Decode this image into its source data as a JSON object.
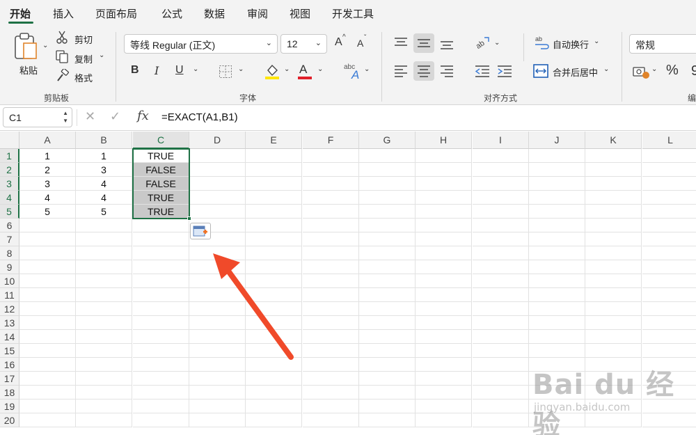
{
  "ribbon_tabs": [
    {
      "label": "开始",
      "active": true
    },
    {
      "label": "插入"
    },
    {
      "label": "页面布局"
    },
    {
      "label": "公式"
    },
    {
      "label": "数据"
    },
    {
      "label": "审阅"
    },
    {
      "label": "视图"
    },
    {
      "label": "开发工具"
    }
  ],
  "clipboard": {
    "paste": "粘贴",
    "cut": "剪切",
    "copy": "复制",
    "format_painter": "格式",
    "group_label": "剪贴板"
  },
  "font": {
    "family": "等线 Regular (正文)",
    "size": "12",
    "grow": "A",
    "shrink": "A",
    "bold": "B",
    "italic": "I",
    "underline": "U",
    "highlight_letter": "A",
    "color_letter": "A",
    "phonetic_top": "abc",
    "phonetic_letter": "A",
    "highlight_color": "#ffe600",
    "font_color": "#e0202a",
    "group_label": "字体"
  },
  "alignment": {
    "wrap_text": "自动换行",
    "merge_center": "合并后居中",
    "wrap_icon_text": "ab",
    "group_label": "对齐方式"
  },
  "number": {
    "format": "常规",
    "percent": "%",
    "group_label": "编"
  },
  "formula_bar": {
    "name_box": "C1",
    "fx": "fx",
    "formula": "=EXACT(A1,B1)"
  },
  "grid": {
    "columns": [
      "A",
      "B",
      "C",
      "D",
      "E",
      "F",
      "G",
      "H",
      "I",
      "J",
      "K",
      "L"
    ],
    "rows": [
      "1",
      "2",
      "3",
      "4",
      "5",
      "6",
      "7",
      "8",
      "9",
      "10",
      "11",
      "12",
      "13",
      "14",
      "15",
      "16",
      "17",
      "18",
      "19",
      "20"
    ],
    "cells": {
      "A": [
        "1",
        "2",
        "3",
        "4",
        "5"
      ],
      "B": [
        "1",
        "3",
        "4",
        "4",
        "5"
      ],
      "C": [
        "TRUE",
        "FALSE",
        "FALSE",
        "TRUE",
        "TRUE"
      ]
    },
    "accent_color": "#1e7145"
  },
  "annotation": {
    "arrow_color": "#f04a2a"
  },
  "watermark": {
    "line1": "Bai du 经验",
    "line2": "jingyan.baidu.com"
  }
}
